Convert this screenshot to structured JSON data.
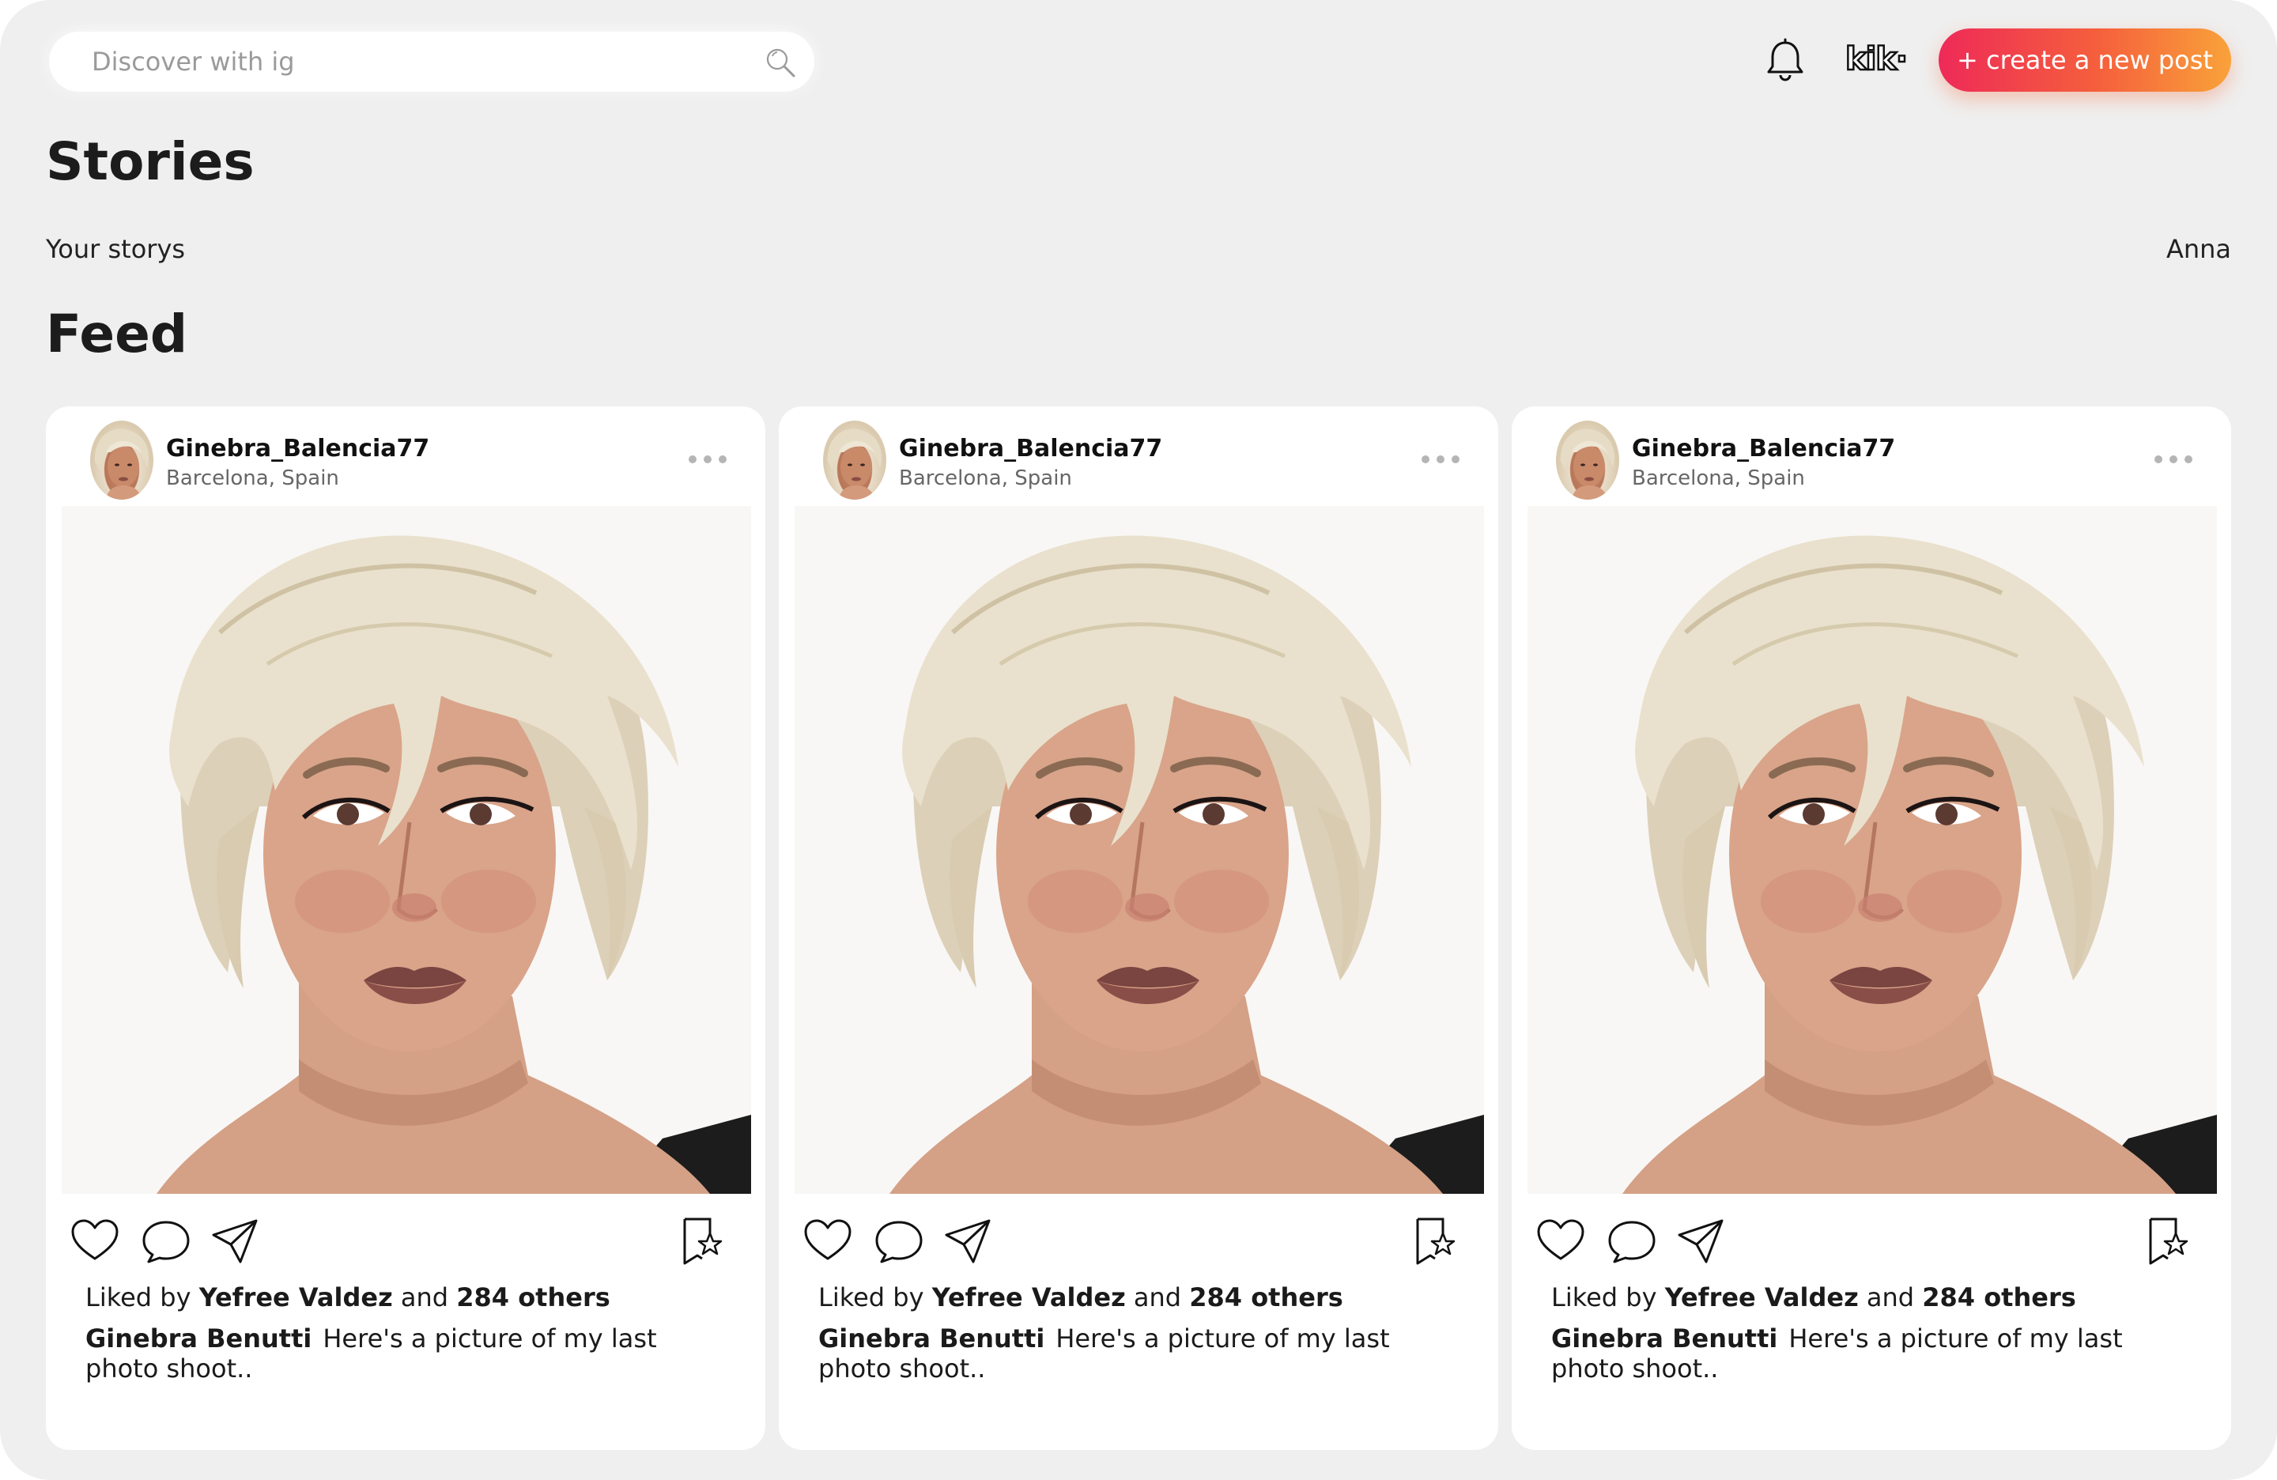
{
  "header": {
    "search_placeholder": "Discover with ig",
    "messenger_logo": "kik·",
    "create_button": "+ create a new post"
  },
  "stories": {
    "title": "Stories",
    "your_stories": "Your storys",
    "items": [
      "Anna"
    ]
  },
  "feed": {
    "title": "Feed",
    "posts": [
      {
        "username": "Ginebra_Balencia77",
        "location": "Barcelona, Spain",
        "liked_prefix": "Liked by",
        "liked_user": "Yefree Valdez",
        "liked_and": "and",
        "liked_others": "284 others",
        "author": "Ginebra Benutti",
        "caption": "Here's a picture of my last photo shoot.."
      },
      {
        "username": "Ginebra_Balencia77",
        "location": "Barcelona, Spain",
        "liked_prefix": "Liked by",
        "liked_user": "Yefree Valdez",
        "liked_and": "and",
        "liked_others": "284 others",
        "author": "Ginebra Benutti",
        "caption": "Here's a picture of my last photo shoot.."
      },
      {
        "username": "Ginebra_Balencia77",
        "location": "Barcelona, Spain",
        "liked_prefix": "Liked by",
        "liked_user": "Yefree Valdez",
        "liked_and": "and",
        "liked_others": "284 others",
        "author": "Ginebra Benutti",
        "caption": "Here's a picture of my last photo shoot.."
      }
    ]
  },
  "icons": {
    "search": "search-icon",
    "notifications": "bell-icon",
    "more": "more-dots-icon",
    "like": "heart-icon",
    "comment": "comment-bubble-icon",
    "share": "paper-plane-icon",
    "save": "bookmark-star-icon"
  },
  "colors": {
    "background": "#efefef",
    "card": "#ffffff",
    "button_gradient_start": "#ee2a58",
    "button_gradient_end": "#f9a23a"
  }
}
